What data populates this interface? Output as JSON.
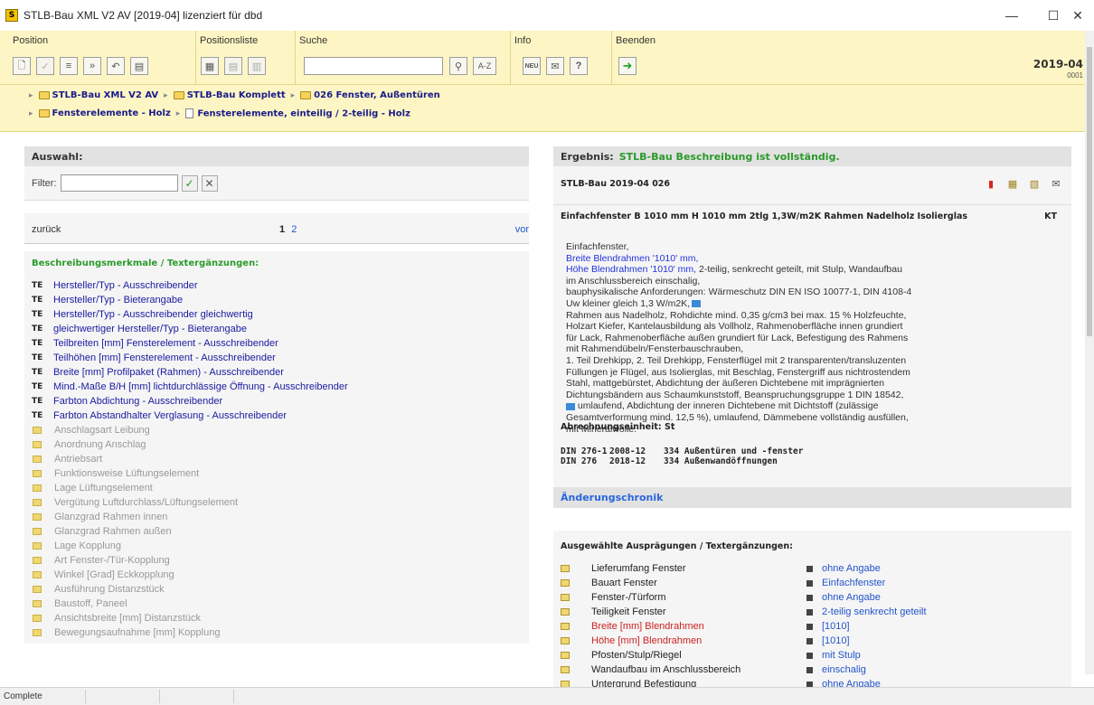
{
  "window": {
    "title": "STLB-Bau XML V2 AV [2019-04] lizenziert für dbd",
    "app_icon": "S",
    "minimize": "—",
    "maximize": "☐",
    "close": "✕"
  },
  "toolbar": {
    "groups": [
      {
        "label": "Position"
      },
      {
        "label": "Positionsliste"
      },
      {
        "label": "Suche"
      },
      {
        "label": "Info"
      },
      {
        "label": "Beenden"
      }
    ],
    "search_placeholder": "",
    "search_btn_label": "A-Z",
    "neu_label": "NEU",
    "help_label": "?",
    "version": "2019-04",
    "version_sub": "0001"
  },
  "breadcrumb": {
    "row1": [
      "STLB-Bau XML V2 AV",
      "STLB-Bau Komplett",
      "026 Fenster, Außentüren"
    ],
    "row2": [
      "Fensterelemente - Holz",
      "Fensterelemente, einteilig / 2-teilig - Holz"
    ],
    "sep": "▸"
  },
  "left": {
    "title": "Auswahl:",
    "filter_label": "Filter:",
    "filter_value": "",
    "ok": "✓",
    "clear": "✕",
    "back": "zurück",
    "page_current": "1",
    "page_next": "2",
    "forward": "vor",
    "features_title": "Beschreibungsmerkmale / Textergänzungen:",
    "te_items": [
      "Hersteller/Typ - Ausschreibender",
      "Hersteller/Typ - Bieterangabe",
      "Hersteller/Typ - Ausschreibender gleichwertig",
      "gleichwertiger Hersteller/Typ - Bieterangabe",
      "Teilbreiten [mm] Fensterelement - Ausschreibender",
      "Teilhöhen [mm] Fensterelement - Ausschreibender",
      "Breite [mm] Profilpaket (Rahmen) - Ausschreibender",
      "Mind.-Maße B/H [mm] lichtdurchlässige Öffnung - Ausschreibender",
      "Farbton Abdichtung - Ausschreibender",
      "Farbton Abstandhalter Verglasung - Ausschreibender"
    ],
    "te_tag": "TE",
    "disabled_items": [
      "Anschlagsart Leibung",
      "Anordnung Anschlag",
      "Antriebsart",
      "Funktionsweise Lüftungselement",
      "Lage Lüftungselement",
      "Vergütung Luftdurchlass/Lüftungselement",
      "Glanzgrad Rahmen innen",
      "Glanzgrad Rahmen außen",
      "Lage Kopplung",
      "Art Fenster-/Tür-Kopplung",
      "Winkel [Grad] Eckkopplung",
      "Ausführung Distanzstück",
      "Baustoff, Paneel",
      "Ansichtsbreite [mm] Distanzstück",
      "Bewegungsaufnahme [mm] Kopplung"
    ]
  },
  "right": {
    "title_key": "Ergebnis:",
    "title_value": "STLB-Bau Beschreibung ist vollständig.",
    "code": "STLB-Bau 2019-04 026",
    "subject": "Einfachfenster B 1010 mm H 1010 mm 2tlg 1,3W/m2K Rahmen Nadelholz Isolierglas",
    "kt": "KT",
    "desc": {
      "l1": "Einfachfenster,",
      "l2": "Breite Blendrahmen '1010' mm,",
      "l3a": "Höhe Blendrahmen '1010' mm,",
      "l3b": " 2-teilig, senkrecht geteilt, mit Stulp, Wandaufbau",
      "l4": "im Anschlussbereich einschalig,",
      "l5": "bauphysikalische Anforderungen: Wärmeschutz DIN EN ISO 10077-1, DIN 4108-4",
      "l6": "Uw kleiner gleich 1,3 W/m2K,",
      "l7": "Rahmen aus Nadelholz, Rohdichte mind. 0,35 g/cm3 bei max. 15 % Holzfeuchte,",
      "l8": "Holzart Kiefer, Kantelausbildung als Vollholz, Rahmenoberfläche innen grundiert",
      "l9": "für Lack, Rahmenoberfläche außen grundiert für Lack, Befestigung des Rahmens",
      "l10": "mit Rahmendübeln/Fensterbauschrauben,",
      "l11": "1. Teil Drehkipp, 2. Teil Drehkipp, Fensterflügel mit 2 transparenten/transluzenten",
      "l12": "Füllungen je Flügel, aus Isolierglas, mit Beschlag, Fenstergriff aus nichtrostendem",
      "l13": "Stahl, mattgebürstet, Abdichtung der äußeren Dichtebene mit imprägnierten",
      "l14": "Dichtungsbändern aus Schaumkunststoff, Beanspruchungsgruppe 1 DIN 18542,",
      "l15": " umlaufend, Abdichtung der inneren Dichtebene mit Dichtstoff (zulässige",
      "l16": "Gesamtverformung mind. 12,5 %), umlaufend, Dämmebene vollständig ausfüllen,",
      "l17": "mit Mineralwolle."
    },
    "abrechnung": "Abrechnungseinheit: St",
    "din_rows": [
      {
        "norm": "DIN 276-1",
        "date": "2008-12",
        "text": "334 Außentüren und -fenster"
      },
      {
        "norm": "DIN 276",
        "date": "2018-12",
        "text": "334 Außenwandöffnungen"
      }
    ],
    "aenderung": "Änderungschronik",
    "auswahl_title": "Ausgewählte Ausprägungen / Textergänzungen:",
    "auswahl": [
      {
        "label": "Lieferumfang Fenster",
        "value": "ohne Angabe",
        "red": false
      },
      {
        "label": "Bauart Fenster",
        "value": "Einfachfenster",
        "red": false
      },
      {
        "label": "Fenster-/Türform",
        "value": "ohne Angabe",
        "red": false
      },
      {
        "label": "Teiligkeit Fenster",
        "value": "2-teilig senkrecht geteilt",
        "red": false
      },
      {
        "label": "Breite [mm] Blendrahmen",
        "value": "[1010]",
        "red": true
      },
      {
        "label": "Höhe [mm] Blendrahmen",
        "value": "[1010]",
        "red": true
      },
      {
        "label": "Pfosten/Stulp/Riegel",
        "value": "mit Stulp",
        "red": false
      },
      {
        "label": "Wandaufbau im Anschlussbereich",
        "value": "einschalig",
        "red": false
      },
      {
        "label": "Untergrund Befestigung",
        "value": "ohne Angabe",
        "red": false
      }
    ]
  },
  "status": {
    "text": "Complete"
  }
}
